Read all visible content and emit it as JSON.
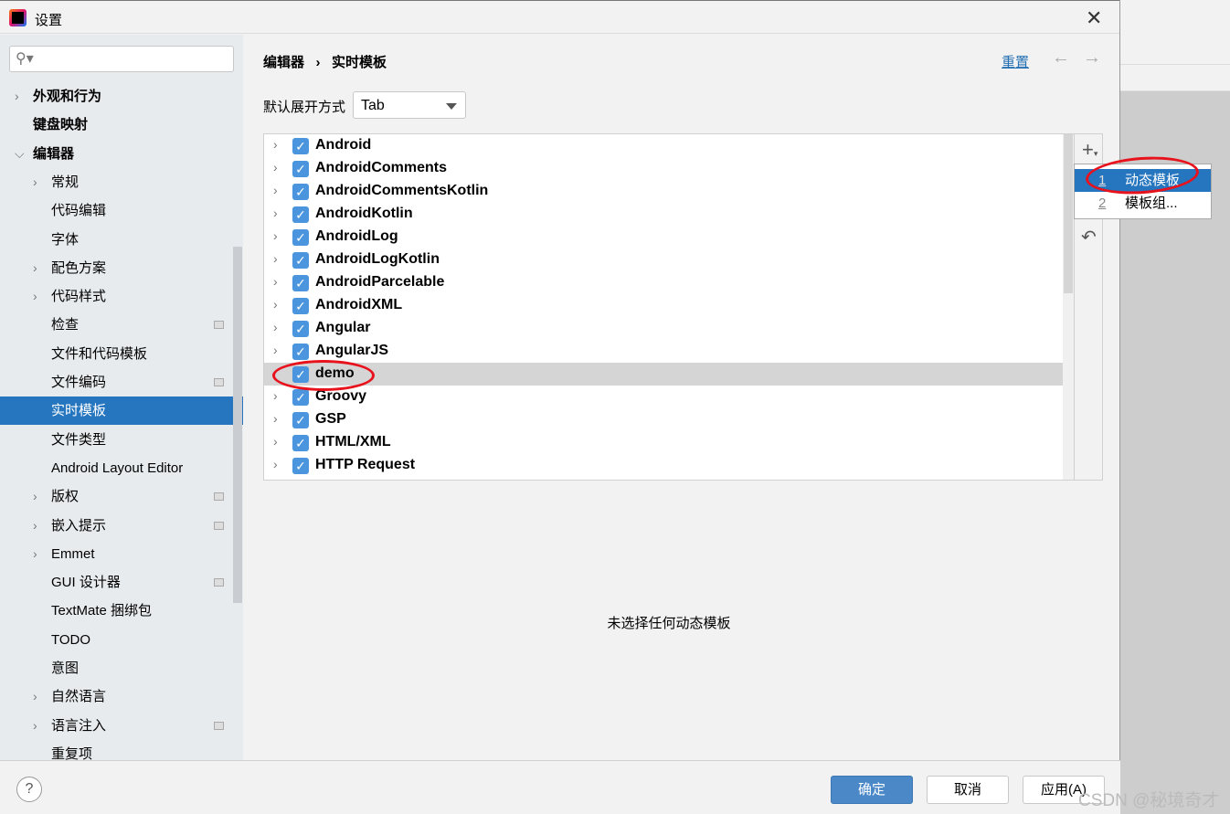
{
  "window": {
    "title": "设置",
    "close_icon": "close-icon"
  },
  "search": {
    "placeholder": ""
  },
  "sidebar": {
    "items": [
      {
        "label": "外观和行为",
        "level": 0,
        "chevron": "right",
        "bold": true,
        "icon": false
      },
      {
        "label": "键盘映射",
        "level": 0,
        "chevron": "",
        "bold": true,
        "icon": false
      },
      {
        "label": "编辑器",
        "level": 0,
        "chevron": "down",
        "bold": true,
        "icon": false
      },
      {
        "label": "常规",
        "level": 1,
        "chevron": "right",
        "icon": false
      },
      {
        "label": "代码编辑",
        "level": 1,
        "chevron": "",
        "icon": false
      },
      {
        "label": "字体",
        "level": 1,
        "chevron": "",
        "icon": false
      },
      {
        "label": "配色方案",
        "level": 1,
        "chevron": "right",
        "icon": false
      },
      {
        "label": "代码样式",
        "level": 1,
        "chevron": "right",
        "icon": false
      },
      {
        "label": "检查",
        "level": 1,
        "chevron": "",
        "icon": true
      },
      {
        "label": "文件和代码模板",
        "level": 1,
        "chevron": "",
        "icon": false
      },
      {
        "label": "文件编码",
        "level": 1,
        "chevron": "",
        "icon": true
      },
      {
        "label": "实时模板",
        "level": 1,
        "chevron": "",
        "icon": false,
        "selected": true
      },
      {
        "label": "文件类型",
        "level": 1,
        "chevron": "",
        "icon": false
      },
      {
        "label": "Android Layout Editor",
        "level": 1,
        "chevron": "",
        "icon": false
      },
      {
        "label": "版权",
        "level": 1,
        "chevron": "right",
        "icon": true
      },
      {
        "label": "嵌入提示",
        "level": 1,
        "chevron": "right",
        "icon": true
      },
      {
        "label": "Emmet",
        "level": 1,
        "chevron": "right",
        "icon": false
      },
      {
        "label": "GUI 设计器",
        "level": 1,
        "chevron": "",
        "icon": true
      },
      {
        "label": "TextMate 捆绑包",
        "level": 1,
        "chevron": "",
        "icon": false
      },
      {
        "label": "TODO",
        "level": 1,
        "chevron": "",
        "icon": false
      },
      {
        "label": "意图",
        "level": 1,
        "chevron": "",
        "icon": false
      },
      {
        "label": "自然语言",
        "level": 1,
        "chevron": "right",
        "icon": false
      },
      {
        "label": "语言注入",
        "level": 1,
        "chevron": "right",
        "icon": true
      },
      {
        "label": "重复项",
        "level": 1,
        "chevron": "",
        "icon": false
      }
    ]
  },
  "breadcrumb": {
    "parent": "编辑器",
    "separator": "›",
    "current": "实时模板"
  },
  "header": {
    "reset": "重置"
  },
  "expand": {
    "label": "默认展开方式",
    "value": "Tab"
  },
  "templates": [
    {
      "name": "Android",
      "checked": true
    },
    {
      "name": "AndroidComments",
      "checked": true
    },
    {
      "name": "AndroidCommentsKotlin",
      "checked": true
    },
    {
      "name": "AndroidKotlin",
      "checked": true
    },
    {
      "name": "AndroidLog",
      "checked": true
    },
    {
      "name": "AndroidLogKotlin",
      "checked": true
    },
    {
      "name": "AndroidParcelable",
      "checked": true
    },
    {
      "name": "AndroidXML",
      "checked": true
    },
    {
      "name": "Angular",
      "checked": true
    },
    {
      "name": "AngularJS",
      "checked": true
    },
    {
      "name": "demo",
      "checked": true,
      "selected": true,
      "expandable": false
    },
    {
      "name": "Groovy",
      "checked": true
    },
    {
      "name": "GSP",
      "checked": true
    },
    {
      "name": "HTML/XML",
      "checked": true
    },
    {
      "name": "HTTP Request",
      "checked": true
    }
  ],
  "popup": {
    "items": [
      {
        "key": "1",
        "label": "动态模板",
        "selected": true
      },
      {
        "key": "2",
        "label": "模板组..."
      }
    ]
  },
  "empty_text": "未选择任何动态模板",
  "footer": {
    "ok": "确定",
    "cancel": "取消",
    "apply": "应用(A)",
    "help": "?"
  },
  "watermark": "CSDN @秘境奇才",
  "colors": {
    "accent": "#2675bf",
    "primary_button": "#4a88c8",
    "annotation": "#e8121c"
  }
}
